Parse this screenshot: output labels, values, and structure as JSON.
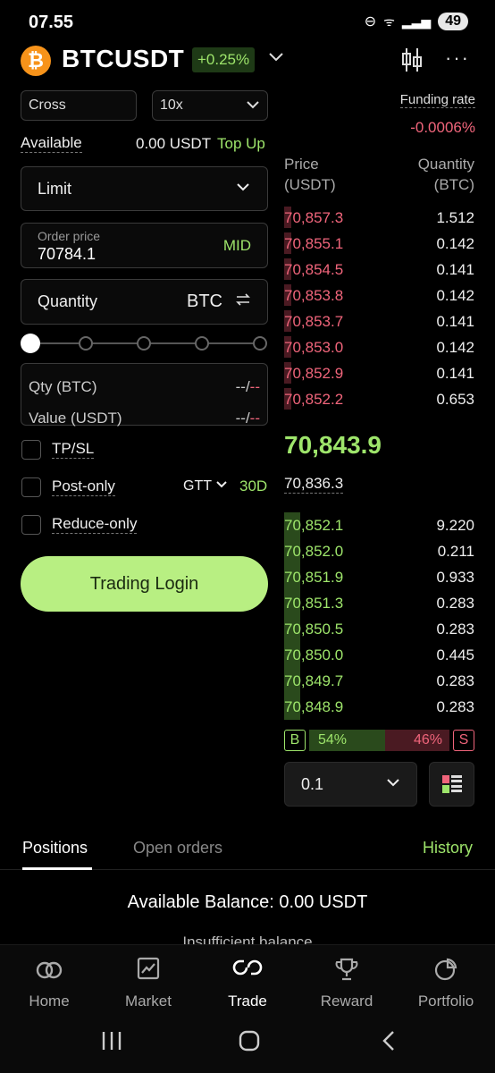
{
  "status": {
    "time": "07.55",
    "battery": "49"
  },
  "header": {
    "logo_symbol": "₿",
    "pair": "BTCUSDT",
    "change": "+0.25%"
  },
  "margin_mode": "Cross",
  "leverage": "10x",
  "funding": {
    "label": "Funding rate",
    "value": "-0.0006%"
  },
  "available": {
    "label": "Available",
    "value": "0.00 USDT",
    "topup": "Top Up"
  },
  "order_type": "Limit",
  "order_price": {
    "label": "Order price",
    "value": "70784.1",
    "mid": "MID"
  },
  "quantity": {
    "label": "Quantity",
    "unit": "BTC"
  },
  "slider": {
    "value": 0,
    "stops": 5
  },
  "summary": {
    "qty_label": "Qty (BTC)",
    "qty_value_a": "--",
    "qty_value_b": "--",
    "value_label": "Value (USDT)",
    "value_value_a": "--",
    "value_value_b": "--"
  },
  "options": {
    "tpsl": "TP/SL",
    "post_only": "Post-only",
    "reduce_only": "Reduce-only",
    "gtt": "GTT",
    "gtt_period": "30D"
  },
  "login_button": "Trading Login",
  "orderbook": {
    "price_header_1": "Price",
    "price_header_2": "(USDT)",
    "qty_header_1": "Quantity",
    "qty_header_2": "(BTC)",
    "asks": [
      {
        "price": "70,857.3",
        "qty": "1.512"
      },
      {
        "price": "70,855.1",
        "qty": "0.142"
      },
      {
        "price": "70,854.5",
        "qty": "0.141"
      },
      {
        "price": "70,853.8",
        "qty": "0.142"
      },
      {
        "price": "70,853.7",
        "qty": "0.141"
      },
      {
        "price": "70,853.0",
        "qty": "0.142"
      },
      {
        "price": "70,852.9",
        "qty": "0.141"
      },
      {
        "price": "70,852.2",
        "qty": "0.653"
      }
    ],
    "last_price": "70,843.9",
    "mark_price": "70,836.3",
    "bids": [
      {
        "price": "70,852.1",
        "qty": "9.220"
      },
      {
        "price": "70,852.0",
        "qty": "0.211"
      },
      {
        "price": "70,851.9",
        "qty": "0.933"
      },
      {
        "price": "70,851.3",
        "qty": "0.283"
      },
      {
        "price": "70,850.5",
        "qty": "0.283"
      },
      {
        "price": "70,850.0",
        "qty": "0.445"
      },
      {
        "price": "70,849.7",
        "qty": "0.283"
      },
      {
        "price": "70,848.9",
        "qty": "0.283"
      }
    ],
    "ratio": {
      "b_label": "B",
      "buy": "54%",
      "sell": "46%",
      "s_label": "S",
      "buy_fraction": 0.54
    },
    "step": "0.1"
  },
  "tabs": {
    "positions": "Positions",
    "open_orders": "Open orders",
    "history": "History"
  },
  "balance_text": "Available Balance: 0.00 USDT",
  "insufficient_text": "Insufficient balance",
  "nav": {
    "home": "Home",
    "market": "Market",
    "trade": "Trade",
    "reward": "Reward",
    "portfolio": "Portfolio"
  },
  "colors": {
    "accent": "#9ee56b",
    "sell": "#f0657b",
    "button": "#b8ef82"
  }
}
